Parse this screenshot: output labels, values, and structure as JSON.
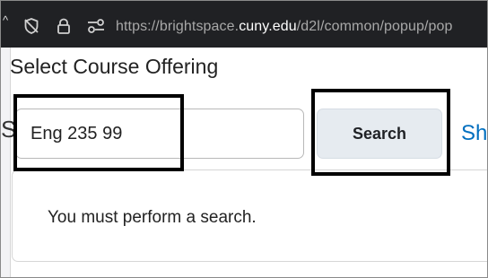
{
  "browser": {
    "edge_fragment": "^",
    "url_prefix": "https://brightspace.",
    "url_domain": "cuny.edu",
    "url_suffix": "/d2l/common/popup/pop",
    "icons": [
      "tracking-protection-icon",
      "lock-icon",
      "site-permissions-icon"
    ]
  },
  "dialog": {
    "title": "Select Course Offering",
    "behind_fragment": "S",
    "search": {
      "value": "Eng 235 99",
      "button_label": "Search",
      "show_link": "Sh"
    },
    "results": {
      "message": "You must perform a search."
    }
  },
  "colors": {
    "url_bar_bg": "#202124",
    "button_bg": "#e6ebf0",
    "link": "#006fbf",
    "highlight": "#000000"
  }
}
